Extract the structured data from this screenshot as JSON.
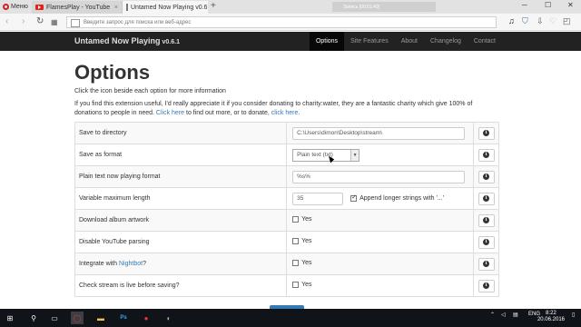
{
  "browser": {
    "menu_label": "Меню",
    "tabs": [
      {
        "title": "FlamesPlay - YouTube",
        "close": "×"
      },
      {
        "title": "Untamed Now Playing v0.6",
        "close": "×"
      }
    ],
    "new_tab": "+",
    "preview_text": "Запись [00:01:40]",
    "address_placeholder": "Введите запрос для поиска или веб-адрес",
    "window_controls": [
      "─",
      "☐",
      "✕"
    ]
  },
  "site": {
    "brand": "Untamed Now Playing",
    "version": "v0.6.1",
    "nav": [
      {
        "label": "Options",
        "active": true
      },
      {
        "label": "Site Features",
        "active": false
      },
      {
        "label": "About",
        "active": false
      },
      {
        "label": "Changelog",
        "active": false
      },
      {
        "label": "Contact",
        "active": false
      }
    ]
  },
  "page": {
    "title": "Options",
    "intro": "Click the icon beside each option for more information",
    "lead_prefix": "If you find this extension useful, I'd really appreciate it if you consider donating to charity:water, they are a fantastic charity which give 100% of donations to people in need.",
    "lead_link1": "Click here",
    "lead_mid": "to find out more, or to donate,",
    "lead_link2": "click here",
    "lead_end": "."
  },
  "options": {
    "save_dir": {
      "label": "Save to directory",
      "value": "C:\\Users\\dimon\\Desktop\\stream\\"
    },
    "save_format": {
      "label": "Save as format",
      "value": "Plain text (txt)"
    },
    "plain_format": {
      "label": "Plain text now playing format",
      "value": "%s%"
    },
    "var_max": {
      "label": "Variable maximum length",
      "value": "35",
      "append_label": "Append longer strings with '...'",
      "append_checked": true
    },
    "download_art": {
      "label": "Download album artwork",
      "yes": "Yes",
      "checked": false
    },
    "disable_yt": {
      "label": "Disable YouTube parsing",
      "yes": "Yes",
      "checked": false
    },
    "nightbot": {
      "label_prefix": "Integrate with",
      "link": "Nightbot",
      "label_suffix": "?",
      "yes": "Yes",
      "checked": false
    },
    "check_stream": {
      "label": "Check stream is live before saving?",
      "yes": "Yes",
      "checked": false
    }
  },
  "taskbar": {
    "lang": "ENG",
    "time": "8:22",
    "date": "20.06.2016"
  },
  "colors": {
    "navbar": "#222222",
    "link": "#337ab7",
    "opera_red": "#d21f2c"
  }
}
